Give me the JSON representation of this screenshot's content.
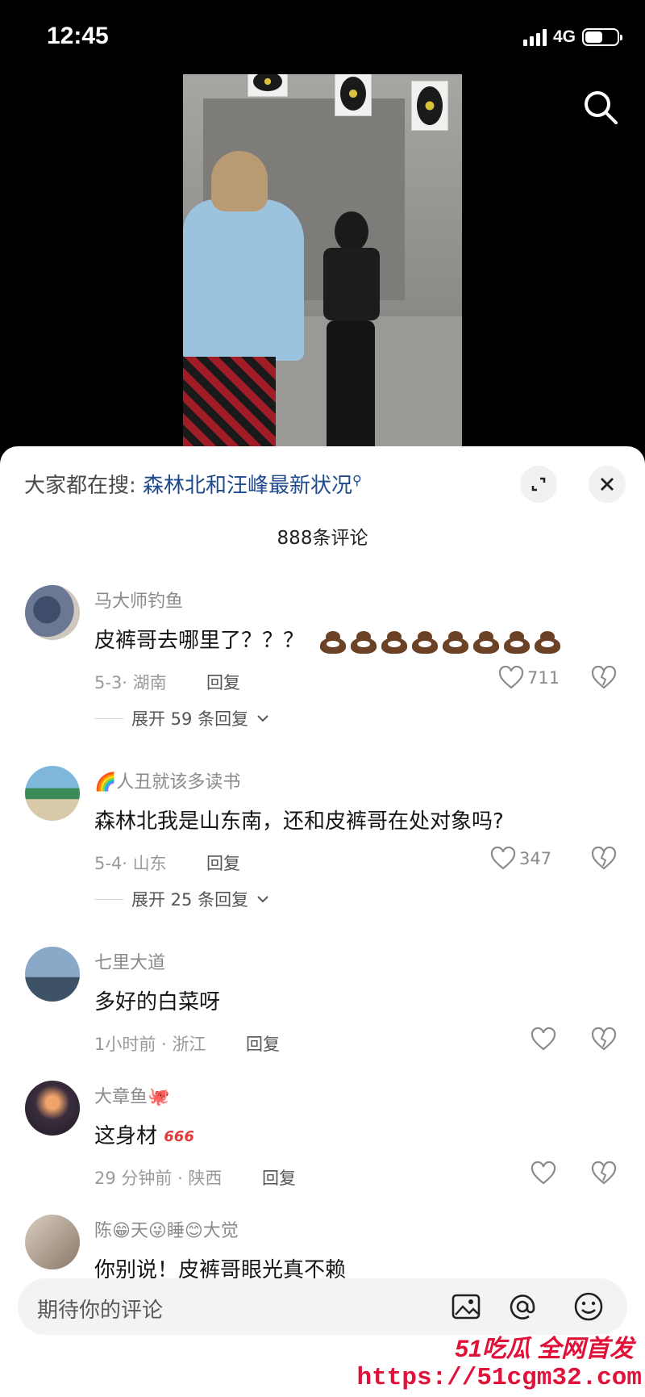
{
  "status_bar": {
    "time": "12:45",
    "network": "4G",
    "battery_level": 0.55
  },
  "video": {
    "icons": [
      "search-icon"
    ]
  },
  "sheet": {
    "search_label": "大家都在搜:",
    "search_term": "森林北和汪峰最新状况",
    "comment_count_title": "888条评论",
    "icons": [
      "expand-icon",
      "close-icon"
    ]
  },
  "comments": [
    {
      "username": "马大师钓鱼",
      "text": "皮裤哥去哪里了？？？",
      "emoji_count": 8,
      "meta": "5-3· 湖南",
      "reply_label": "回复",
      "likes": "711",
      "expand": "展开 59 条回复"
    },
    {
      "username": "🌈人丑就该多读书",
      "text": "森林北我是山东南，还和皮裤哥在处对象吗?",
      "meta": "5-4· 山东",
      "reply_label": "回复",
      "likes": "347",
      "expand": "展开 25 条回复"
    },
    {
      "username": "七里大道",
      "text": "多好的白菜呀",
      "meta": "1小时前 · 浙江",
      "reply_label": "回复",
      "likes": ""
    },
    {
      "username": "大章鱼🐙",
      "text": "这身材",
      "badge": "666",
      "meta": "29 分钟前 · 陕西",
      "reply_label": "回复",
      "likes": ""
    },
    {
      "username": "陈😁天😜睡😊大觉",
      "text": "你别说！皮裤哥眼光真不赖"
    }
  ],
  "input": {
    "placeholder": "期待你的评论",
    "icons": [
      "image-icon",
      "at-icon",
      "emoji-icon"
    ]
  },
  "watermark": {
    "title": "51吃瓜 全网首发",
    "url": "https://51cgm32.com"
  }
}
